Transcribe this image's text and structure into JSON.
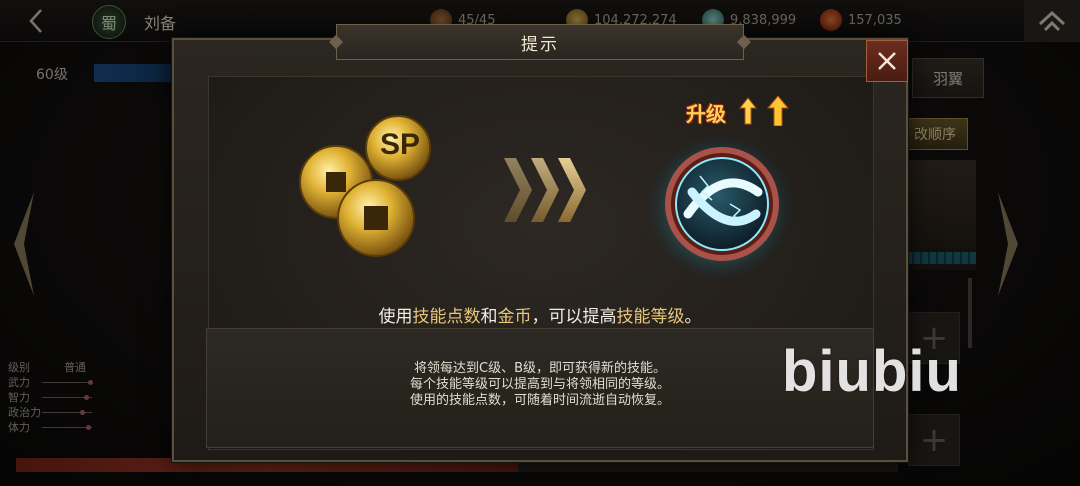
{
  "topbar": {
    "faction_label": "蜀",
    "hero_name": "刘备",
    "stamina": "45/45",
    "gold": "104,272,274",
    "jade": "9,838,999",
    "gem": "157,035"
  },
  "level": {
    "label": "60级"
  },
  "stats": [
    {
      "label": "级别",
      "value": "普通"
    },
    {
      "label": "武力",
      "value": ""
    },
    {
      "label": "智力",
      "value": ""
    },
    {
      "label": "政治力",
      "value": ""
    },
    {
      "label": "体力",
      "value": ""
    }
  ],
  "side": {
    "tab_label": "羽翼",
    "order_label": "改顺序"
  },
  "dialog": {
    "title": "提示",
    "upgrade_label": "升级",
    "coin_label": "SP",
    "headline": {
      "p1": "使用",
      "skill_points": "技能点数",
      "p2": "和",
      "gold": "金币",
      "p3": "，可以提高",
      "skill_level": "技能等级",
      "p4": "。"
    },
    "description": [
      "将领每达到C级、B级，即可获得新的技能。",
      "每个技能等级可以提高到与将领相同的等级。",
      "使用的技能点数，可随着时间流逝自动恢复。"
    ]
  },
  "watermark": "biubiu",
  "colors": {
    "accent_gold": "#e8c67a",
    "close_red": "#6b2e20",
    "skill_glow": "#41d8e8"
  }
}
